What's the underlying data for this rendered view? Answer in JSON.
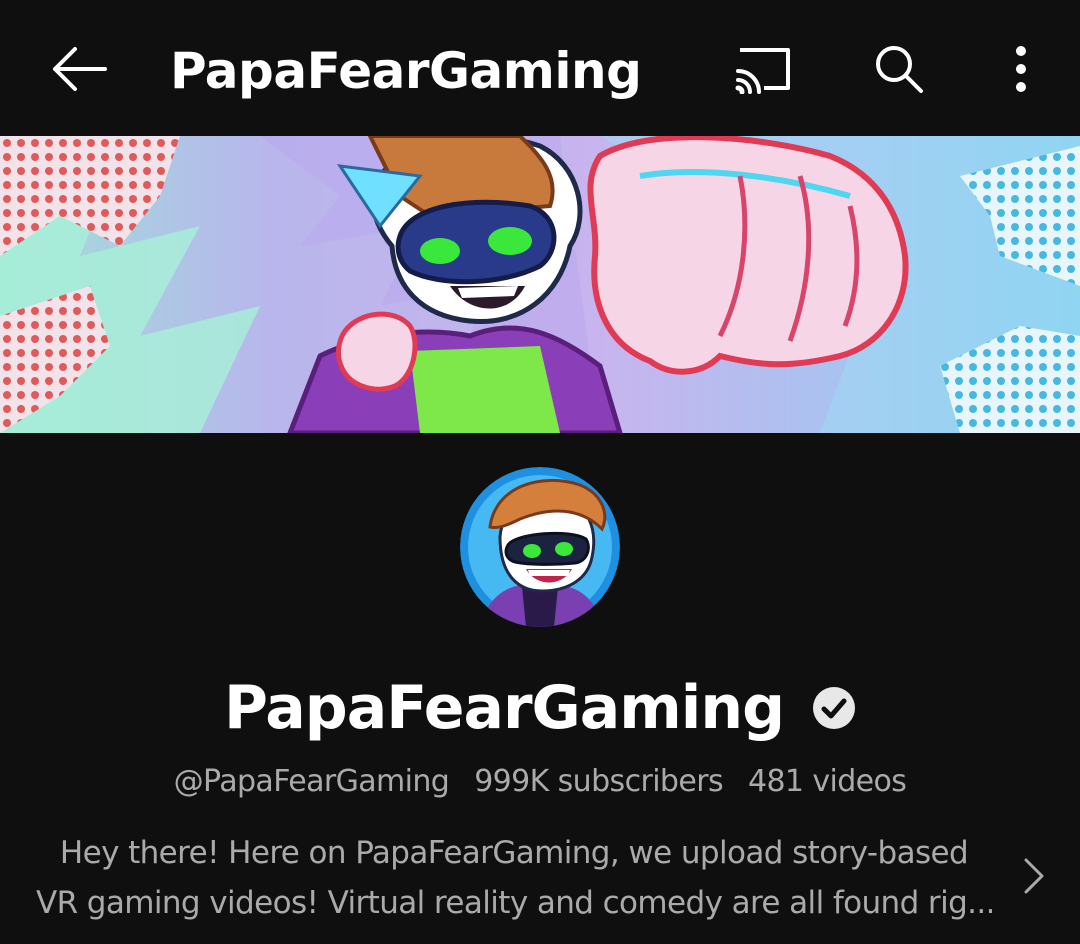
{
  "topbar": {
    "title": "PapaFearGaming",
    "icons": [
      "back-arrow-icon",
      "cast-icon",
      "search-icon",
      "more-vertical-icon"
    ]
  },
  "banner": {
    "description_hidden": true
  },
  "channel": {
    "name": "PapaFearGaming",
    "handle": "@PapaFearGaming",
    "subscribers": "999K subscribers",
    "videos": "481 videos",
    "description_line1": "Hey there! Here on PapaFearGaming, we upload story-based",
    "description_line2": "VR gaming videos! Virtual reality and comedy are all found rig..."
  },
  "colors": {
    "background": "#0f0f0f",
    "text_primary": "#ffffff",
    "text_secondary": "#aaaaaa"
  }
}
